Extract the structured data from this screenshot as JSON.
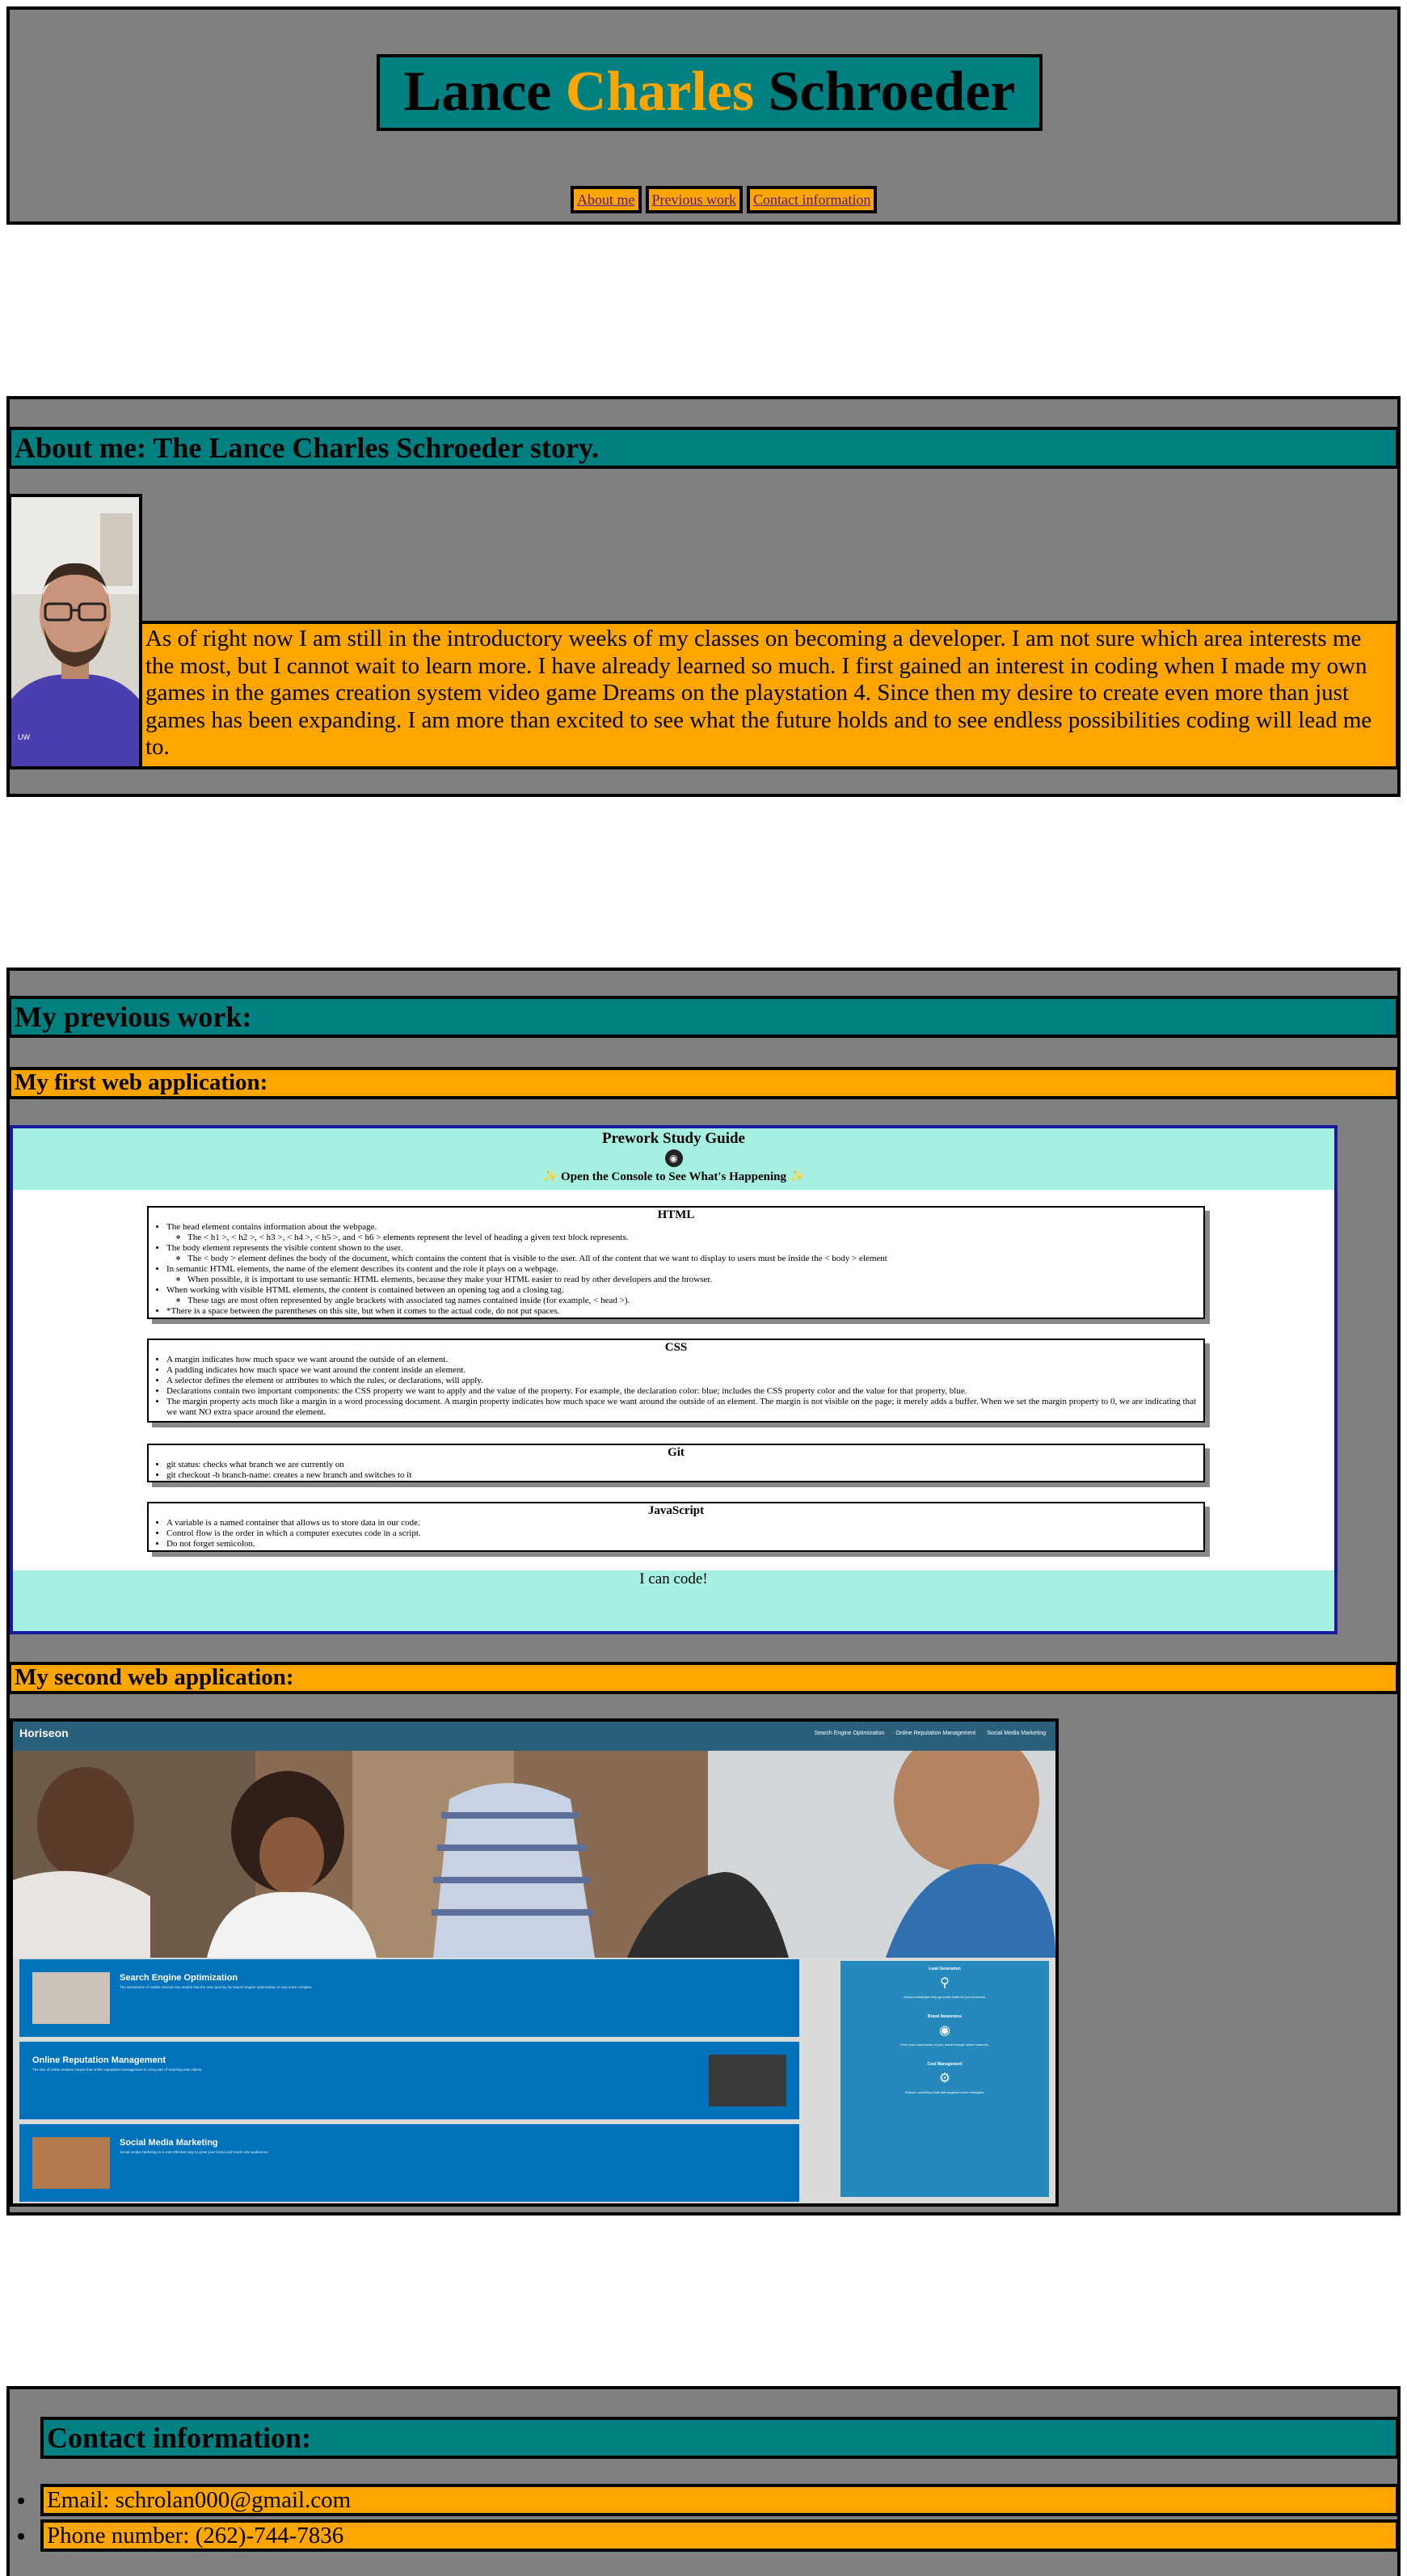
{
  "header": {
    "title_first": "Lance",
    "title_middle": "Charles",
    "title_last": "Schroeder",
    "nav": [
      "About me",
      "Previous work",
      "Contact information"
    ]
  },
  "about": {
    "heading": "About me: The Lance Charles Schroeder story.",
    "body": "As of right now I am still in the introductory weeks of my classes on becoming a developer. I am not sure which area interests me the most, but I cannot wait to learn more. I have already learned so much. I first gained an interest in coding when I made my own games in the games creation system video game Dreams on the playstation 4. Since then my desire to create even more than just games has been expanding. I am more than excited to see what the future holds and to see endless possibilities coding will lead me to."
  },
  "work": {
    "heading": "My previous work:",
    "app1_heading": "My first web application:",
    "app2_heading": "My second web application:",
    "app1": {
      "title": "Prework Study Guide",
      "console": "Open the Console to See What's Happening",
      "html_heading": "HTML",
      "html_items": [
        "The head element contains information about the webpage.",
        "The body element represents the visible content shown to the user.",
        "In semantic HTML elements, the name of the element describes its content and the role it plays on a webpage.",
        "When working with visible HTML elements, the content is contained between an opening tag and a closing tag.",
        "*There is a space between the parentheses on this site, but when it comes to the actual code, do not put spaces."
      ],
      "html_subitems": [
        "The < h1 >, < h2 >, < h3 >, < h4 >, < h5 >, and < h6 > elements represent the level of heading a given text block represents.",
        "The < body > element defines the body of the document, which contains the content that is visible to the user. All of the content that we want to display to users must be inside the < body > element",
        "When possible, it is important to use semantic HTML elements, because they make your HTML easier to read by other developers and the browser.",
        "These tags are most often represented by angle brackets with associated tag names contained inside (for example, < head >)."
      ],
      "css_heading": "CSS",
      "css_items": [
        "A margin indicates how much space we want around the outside of an element.",
        "A padding indicates how much space we want around the content inside an element.",
        "A selector defines the element or attributes to which the rules, or declarations, will apply.",
        "Declarations contain two important components: the CSS property we want to apply and the value of the property. For example, the declaration color: blue; includes the CSS property color and the value for that property, blue.",
        "The margin property acts much like a margin in a word processing document. A margin property indicates how much space we want around the outside of an element. The margin is not visible on the page; it merely adds a buffer. When we set the margin property to 0, we are indicating that we want NO extra space around the element."
      ],
      "git_heading": "Git",
      "git_items": [
        "git status: checks what branch we are currently on",
        "git checkout -b branch-name: creates a new branch and switches to it"
      ],
      "js_heading": "JavaScript",
      "js_items": [
        "A variable is a named container that allows us to store data in our code.",
        "Control flow is the order in which a computer executes code in a script.",
        "Do not forget semicolon."
      ],
      "footer": "I can code!"
    },
    "app2": {
      "brand": "Horiseon",
      "nav": [
        "Search Engine Optimization",
        "Online Reputation Management",
        "Social Media Marketing"
      ],
      "services": [
        {
          "title": "Search Engine Optimization",
          "body": "The dominance of mobile internet use means that the user journey for search engine optimization is now more complex."
        },
        {
          "title": "Online Reputation Management",
          "body": "The rise of online reviews means that online reputation management is a key part of reaching new clients."
        },
        {
          "title": "Social Media Marketing",
          "body": "Social media marketing is a cost-effective way to grow your brand and reach new audiences."
        }
      ],
      "benefits": [
        {
          "title": "Lead Generation",
          "body": "Inbound strategies help generate leads for your business."
        },
        {
          "title": "Brand Awareness",
          "body": "Drive more awareness of your brand through online channels."
        },
        {
          "title": "Cost Management",
          "body": "Reduce marketing costs with targeted online strategies."
        }
      ]
    }
  },
  "contact": {
    "heading": "Contact information:",
    "email": "Email: schrolan000@gmail.com",
    "phone": "Phone number: (262)-744-7836"
  }
}
